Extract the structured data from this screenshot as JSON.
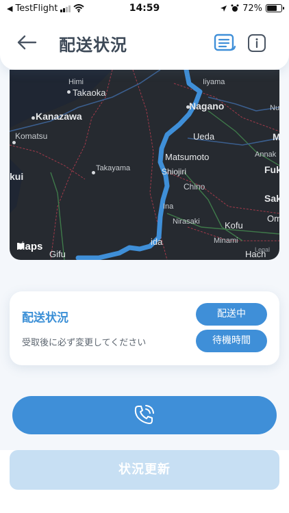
{
  "status_bar": {
    "back_app": "TestFlight",
    "time": "14:59",
    "battery": "72%",
    "battery_level": 0.72
  },
  "header": {
    "title": "配送状況",
    "back_icon": "arrow-left-icon",
    "list_icon": "list-document-icon",
    "info_icon": "info-icon"
  },
  "map": {
    "attribution": "Maps",
    "legal": "Legal",
    "places": {
      "himi": "Himi",
      "takaoka": "Takaoka",
      "iiyama": "Iiyama",
      "nagano": "Nagano",
      "kanazawa": "Kanazawa",
      "nu": "Nu",
      "komatsu": "Komatsu",
      "ueda": "Ueda",
      "m": "M",
      "matsumoto": "Matsumoto",
      "annak": "Annak",
      "takayama": "Takayama",
      "shiojiri": "Shiojiri",
      "fukay": "Fukay",
      "kui": "kui",
      "chino": "Chino",
      "sak": "Sak",
      "ina": "Ina",
      "nirasaki": "Nirasaki",
      "kofu": "Kofu",
      "om": "Om",
      "minami": "Minami",
      "ida": "ida",
      "gifu": "Gifu",
      "hach": "Hach"
    },
    "route_color": "#3f8fd8"
  },
  "status_card": {
    "title": "配送状況",
    "note": "受取後に必ず変更してください",
    "delivering": "配送中",
    "waiting": "待機時間"
  },
  "call_button": {
    "icon": "phone-icon"
  },
  "update_button": {
    "label": "状況更新"
  },
  "colors": {
    "accent": "#3f8fd8",
    "disabled": "#c7dff3",
    "title": "#3d4957"
  }
}
